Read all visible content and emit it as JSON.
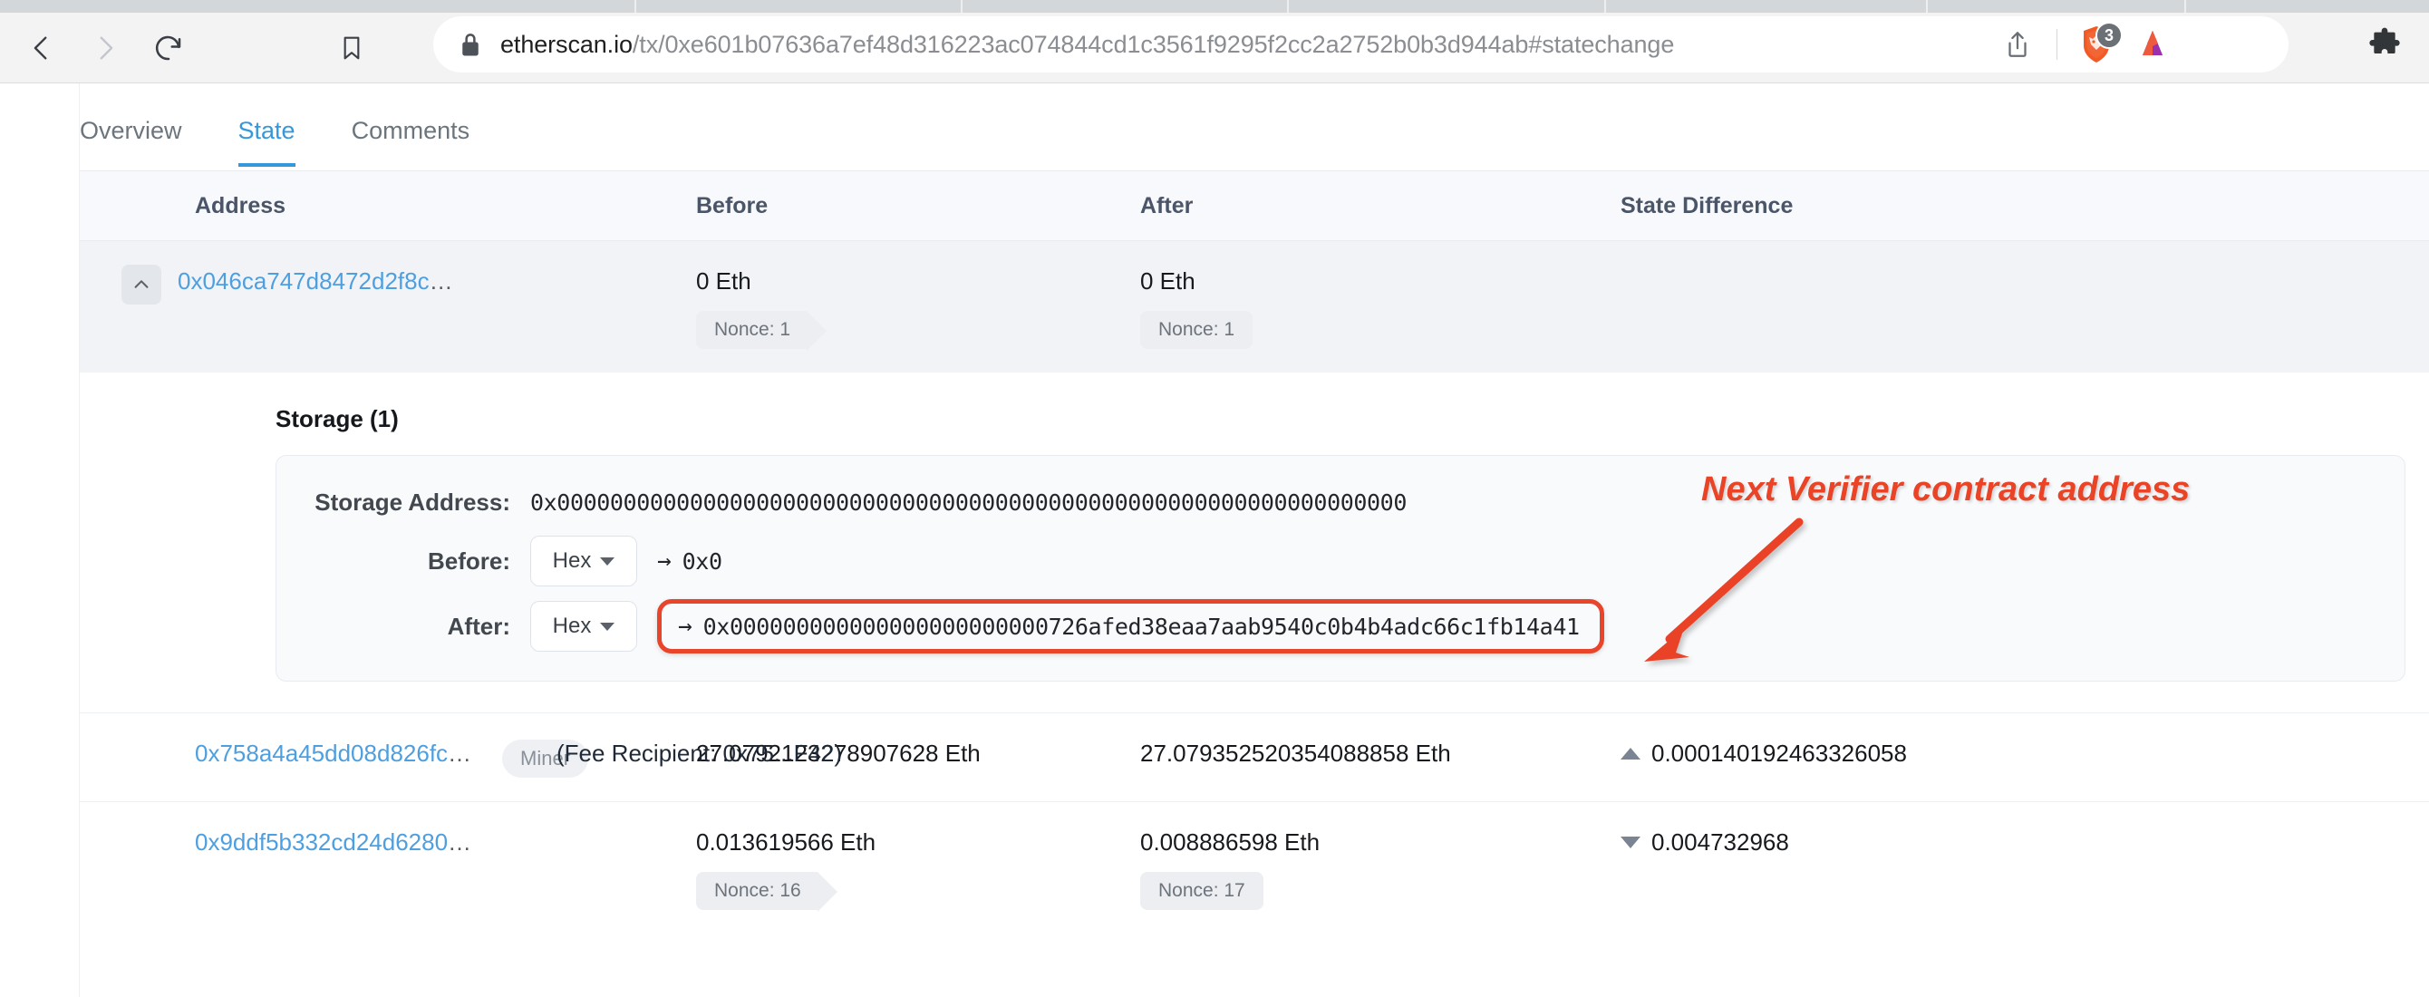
{
  "browser": {
    "nav": {
      "back_icon": "back-arrow-icon",
      "forward_icon": "forward-arrow-icon",
      "reload_icon": "reload-icon",
      "bookmark_icon": "bookmark-icon"
    },
    "omnibox": {
      "lock_icon": "lock-icon",
      "host": "etherscan.io",
      "path": "/tx/0xe601b07636a7ef48d316223ac074844cd1c3561f9295f2cc2a2752b0b3d944ab#statechange",
      "full_url": "etherscan.io/tx/0xe601b07636a7ef48d316223ac074844cd1c3561f9295f2cc2a2752b0b3d944ab#statechange"
    },
    "actions": {
      "share_icon": "share-upload-icon",
      "shields_icon": "brave-shields-lion-icon",
      "shields_count": "3",
      "rewards_icon": "brave-rewards-bat-triangle-icon",
      "extensions_icon": "puzzle-piece-extensions-icon"
    }
  },
  "tabs": [
    {
      "label": "Overview",
      "active": false
    },
    {
      "label": "State",
      "active": true
    },
    {
      "label": "Comments",
      "active": false
    }
  ],
  "table": {
    "headers": {
      "address": "Address",
      "before": "Before",
      "after": "After",
      "difference": "State Difference"
    },
    "rows": [
      {
        "address": "0x046ca747d8472d2f8c",
        "address_ellipsis": "…",
        "collapse_icon": "chevron-up-icon",
        "before_value": "0 Eth",
        "before_nonce": "Nonce: 1",
        "after_value": "0 Eth",
        "after_nonce": "Nonce: 1",
        "difference": ""
      },
      {
        "address": "0x758a4a45dd08d826fc",
        "address_ellipsis": "…",
        "tag": "Miner",
        "note": "(Fee Recipient: 0x75...F42)",
        "before_value": "27.0792123278907628 Eth",
        "after_value": "27.079352520354088858 Eth",
        "difference": "0.000140192463326058",
        "difference_direction": "up"
      },
      {
        "address": "0x9ddf5b332cd24d6280",
        "address_ellipsis": "…",
        "before_value": "0.013619566 Eth",
        "before_nonce": "Nonce: 16",
        "after_value": "0.008886598 Eth",
        "after_nonce": "Nonce: 17",
        "difference": "0.004732968",
        "difference_direction": "down"
      }
    ]
  },
  "storage": {
    "title": "Storage (1)",
    "address_label": "Storage Address:",
    "address_value": "0x0000000000000000000000000000000000000000000000000000000000000000",
    "before_label": "Before:",
    "before_format": "Hex",
    "before_arrow": "→",
    "before_value": "0x0",
    "after_label": "After:",
    "after_format": "Hex",
    "after_arrow": "→",
    "after_value": "0x000000000000000000000000726afed38eaa7aab9540c0b4b4adc66c1fb14a41"
  },
  "annotation": {
    "text": "Next Verifier contract address",
    "color": "#ea4326",
    "arrow_icon": "annotation-arrow-icon",
    "highlight_color": "#e8452b"
  }
}
